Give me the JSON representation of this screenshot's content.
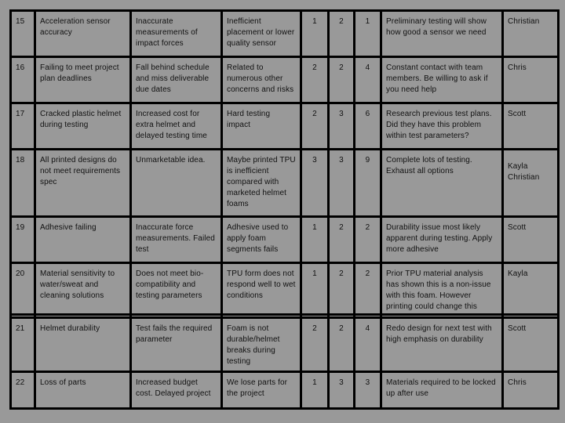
{
  "rows": [
    {
      "id": "15",
      "risk": "Acceleration sensor accuracy",
      "impact": "Inaccurate measurements of impact forces",
      "cause": "Inefficient placement or lower quality sensor",
      "likelihood": "1",
      "severity": "2",
      "score": "1",
      "mitigation": "Preliminary testing will show how good a sensor we need",
      "owner": "Christian"
    },
    {
      "id": "16",
      "risk": "Failing to meet project plan deadlines",
      "impact": "Fall behind schedule and miss deliverable due dates",
      "cause": "Related to numerous other concerns and risks",
      "likelihood": "2",
      "severity": "2",
      "score": "4",
      "mitigation": "Constant contact with team members. Be willing to ask if you need help",
      "owner": "Chris"
    },
    {
      "id": "17",
      "risk": "Cracked plastic helmet during testing",
      "impact": "Increased cost for extra helmet and delayed testing time",
      "cause": "Hard testing impact",
      "likelihood": "2",
      "severity": "3",
      "score": "6",
      "mitigation": "Research previous test plans. Did they have this problem within test parameters?",
      "owner": "Scott"
    },
    {
      "id": "18",
      "risk": "All printed designs do not meet requirements spec",
      "impact": "Unmarketable idea.",
      "cause": "Maybe printed TPU is inefficient compared with marketed helmet foams",
      "likelihood": "3",
      "severity": "3",
      "score": "9",
      "mitigation": "Complete lots of testing. Exhaust all options",
      "owner": "Kayla Christian"
    },
    {
      "id": "19",
      "risk": "Adhesive failing",
      "impact": "Inaccurate force measurements. Failed test",
      "cause": "Adhesive used to apply foam segments fails",
      "likelihood": "1",
      "severity": "2",
      "score": "2",
      "mitigation": "Durability issue most likely apparent during testing. Apply more adhesive",
      "owner": "Scott"
    },
    {
      "id": "20",
      "risk": "Material sensitivity to water/sweat and cleaning solutions",
      "impact": "Does not meet bio-compatibility and testing parameters",
      "cause": "TPU form does not respond well to wet conditions",
      "likelihood": "1",
      "severity": "2",
      "score": "2",
      "mitigation": "Prior TPU material analysis has shown this is a non-issue with this foam. However printing could change this",
      "owner": "Kayla"
    },
    {
      "id": "21",
      "risk": "Helmet durability",
      "impact": "Test fails the required parameter",
      "cause": "Foam is not durable/helmet breaks during testing",
      "likelihood": "2",
      "severity": "2",
      "score": "4",
      "mitigation": "Redo design for next test with high emphasis on durability",
      "owner": "Scott"
    },
    {
      "id": "22",
      "risk": "Loss of parts",
      "impact": "Increased budget cost. Delayed project",
      "cause": "We lose parts for the project",
      "likelihood": "1",
      "severity": "3",
      "score": "3",
      "mitigation": "Materials required to be locked up after use",
      "owner": "Chris"
    }
  ]
}
